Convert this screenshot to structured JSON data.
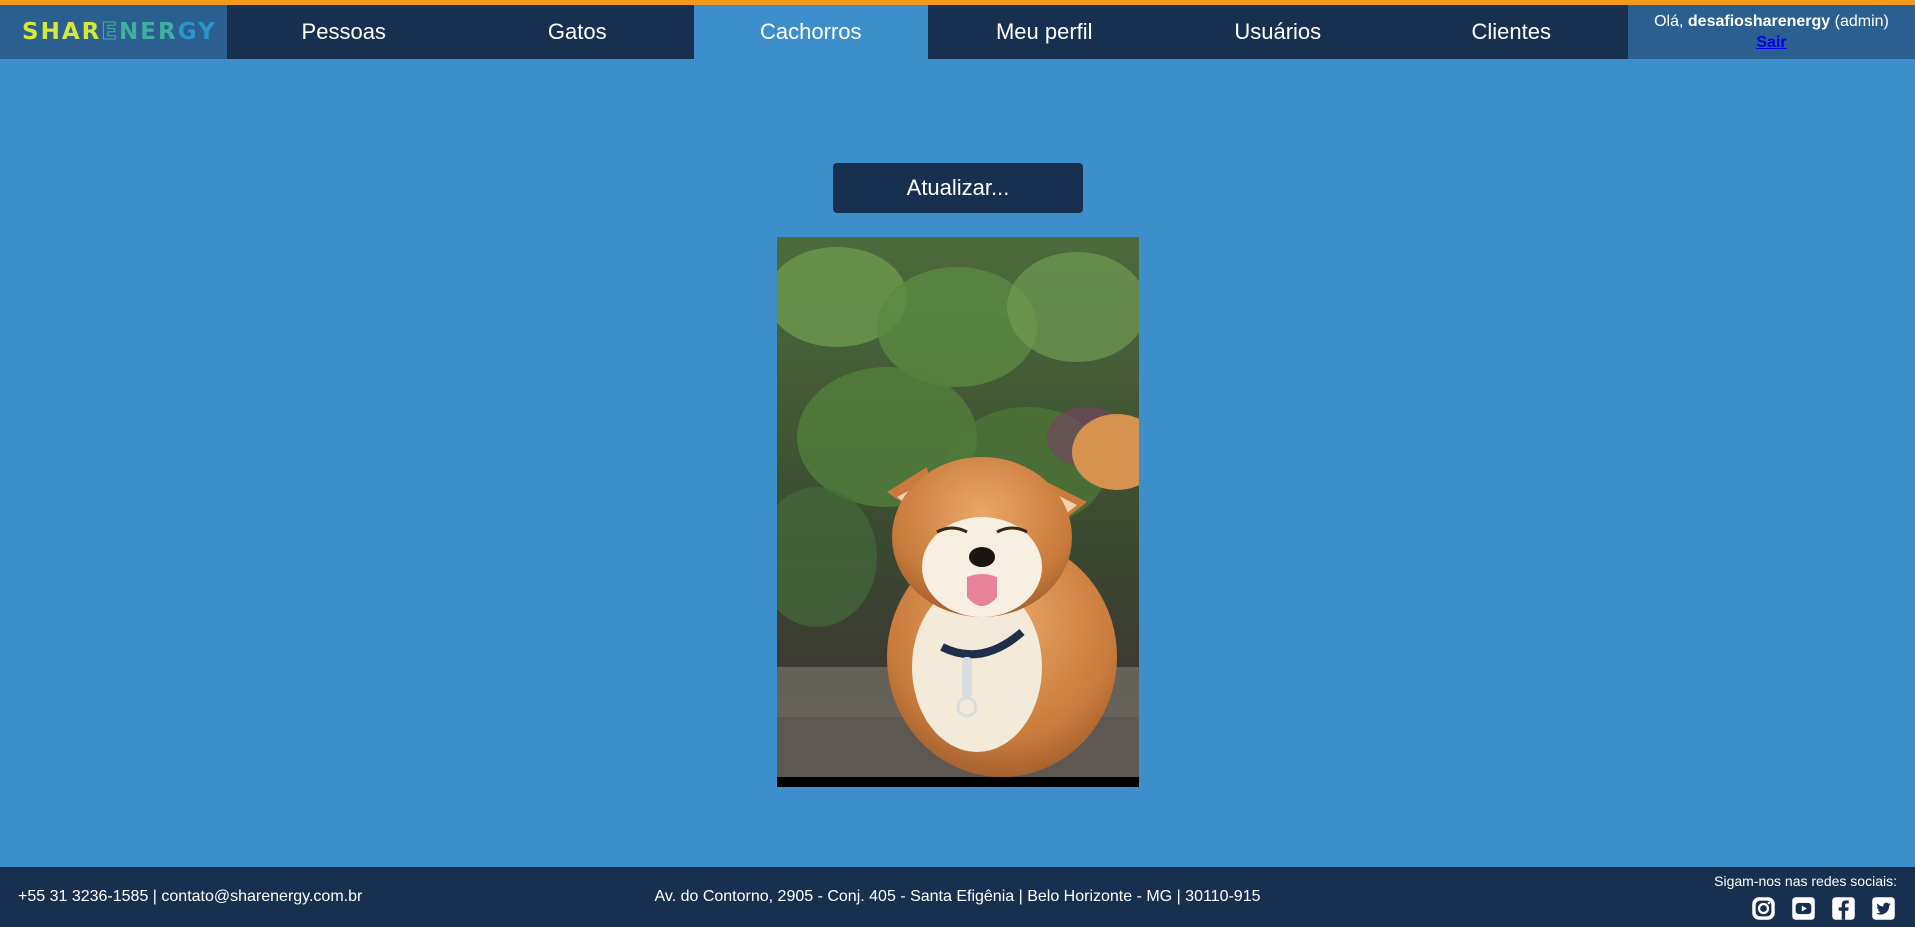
{
  "brand": {
    "logo_part1": "SHAR",
    "logo_e": "E",
    "logo_part2": "NER",
    "logo_part3": "GY"
  },
  "nav": {
    "items": [
      {
        "label": "Pessoas",
        "active": false
      },
      {
        "label": "Gatos",
        "active": false
      },
      {
        "label": "Cachorros",
        "active": true
      },
      {
        "label": "Meu perfil",
        "active": false
      },
      {
        "label": "Usuários",
        "active": false
      },
      {
        "label": "Clientes",
        "active": false
      }
    ]
  },
  "user": {
    "greeting": "Olá,",
    "username": "desafiosharenergy",
    "role": "(admin)",
    "logout_label": "Sair"
  },
  "main": {
    "refresh_label": "Atualizar...",
    "image_subject": "shiba inu dog sticking out tongue"
  },
  "footer": {
    "contact": "+55 31 3236-1585 | contato@sharenergy.com.br",
    "address": "Av. do Contorno, 2905 - Conj. 405 - Santa Efigênia | Belo Horizonte - MG | 30110-915",
    "social_label": "Sigam-nos nas redes sociais:",
    "social_icons": [
      "instagram-icon",
      "youtube-icon",
      "facebook-icon",
      "twitter-icon"
    ]
  },
  "colors": {
    "accent_stripe": "#f39a1c",
    "nav_bg": "#18304f",
    "active_bg": "#3d8fcb",
    "page_bg": "#3d8fcb"
  }
}
